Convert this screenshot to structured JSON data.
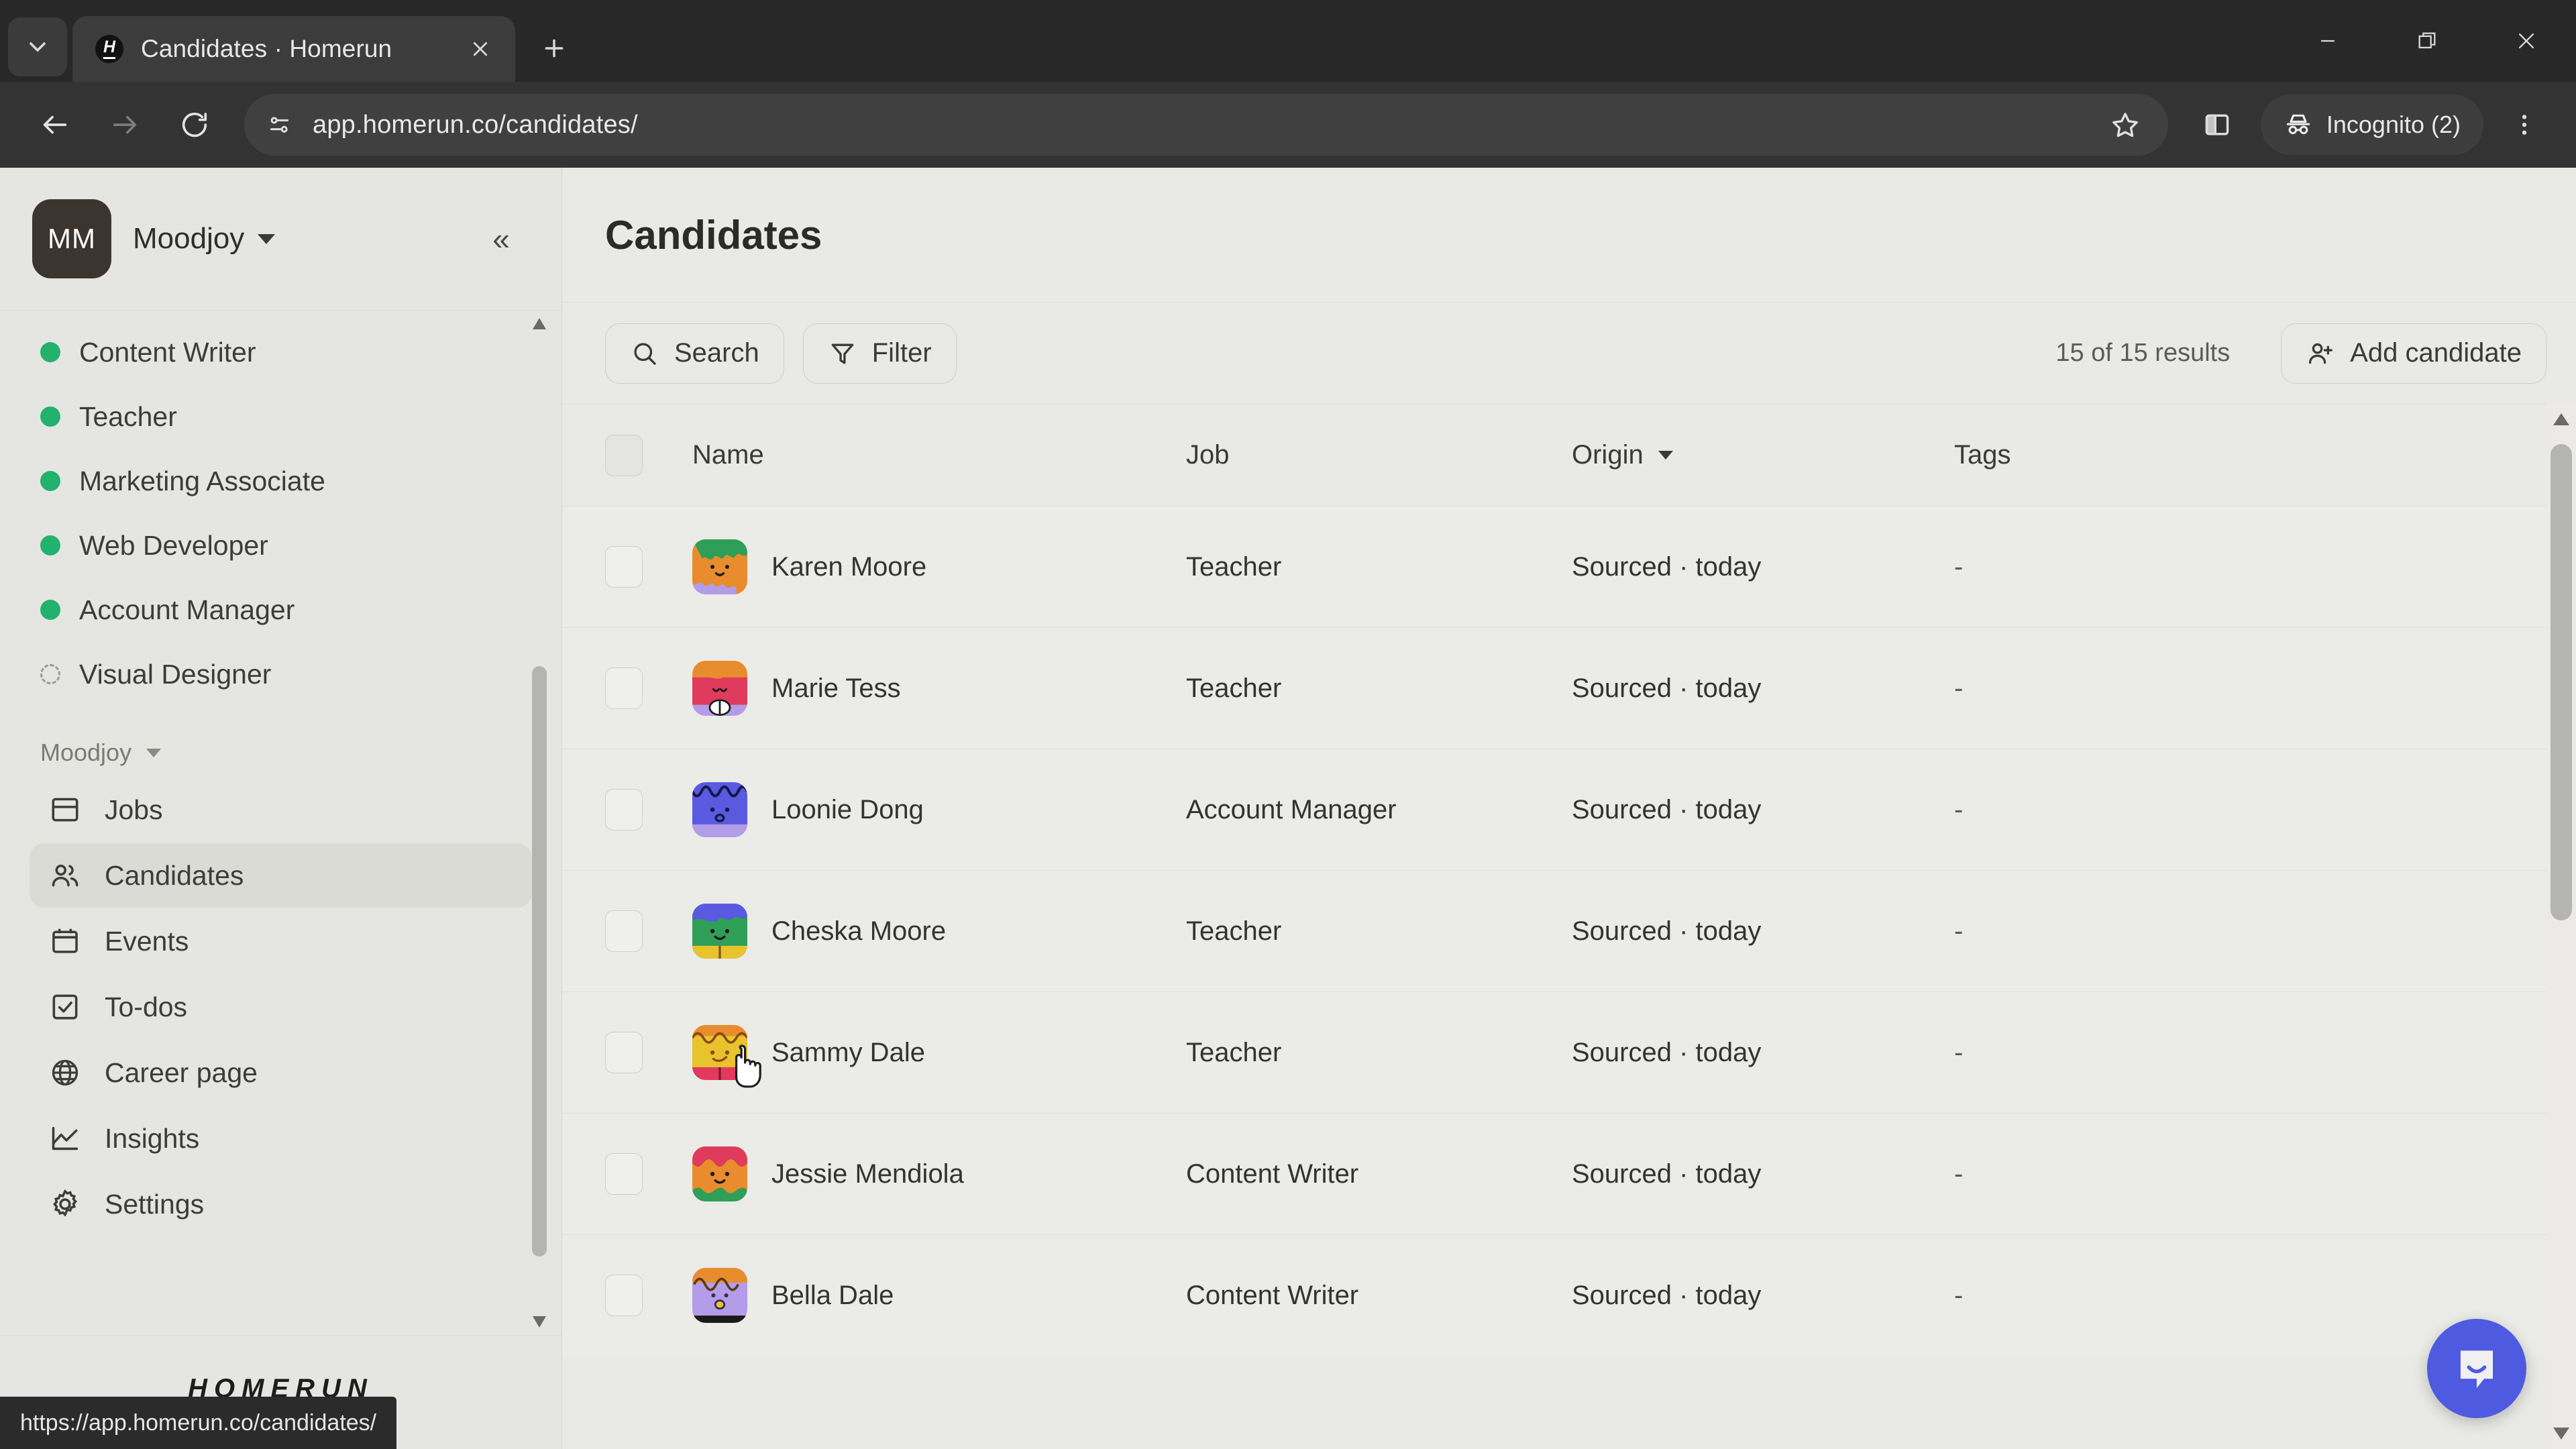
{
  "browser": {
    "tab": {
      "title": "Candidates · Homerun",
      "favicon_letter": "H"
    },
    "new_tab_label": "+",
    "address": "app.homerun.co/candidates/",
    "profile_label": "Incognito (2)",
    "status_url": "https://app.homerun.co/candidates/",
    "window": {
      "minimize": "–",
      "maximize": "❐",
      "close": "✕"
    }
  },
  "sidebar": {
    "org": {
      "initials": "MM",
      "name": "Moodjoy"
    },
    "jobs": [
      {
        "label": "Content Writer",
        "status": "published"
      },
      {
        "label": "Teacher",
        "status": "published"
      },
      {
        "label": "Marketing Associate",
        "status": "published"
      },
      {
        "label": "Web Developer",
        "status": "published"
      },
      {
        "label": "Account Manager",
        "status": "published"
      },
      {
        "label": "Visual Designer",
        "status": "draft"
      }
    ],
    "section_label": "Moodjoy",
    "nav": [
      {
        "label": "Jobs",
        "icon": "jobs-icon",
        "active": false
      },
      {
        "label": "Candidates",
        "icon": "candidates-icon",
        "active": true
      },
      {
        "label": "Events",
        "icon": "events-icon",
        "active": false
      },
      {
        "label": "To-dos",
        "icon": "todos-icon",
        "active": false
      },
      {
        "label": "Career page",
        "icon": "career-page-icon",
        "active": false
      },
      {
        "label": "Insights",
        "icon": "insights-icon",
        "active": false
      },
      {
        "label": "Settings",
        "icon": "settings-icon",
        "active": false
      }
    ],
    "footer_logo": "HOMERUN"
  },
  "main": {
    "title": "Candidates",
    "toolbar": {
      "search_label": "Search",
      "filter_label": "Filter",
      "results_label": "15 of 15 results",
      "add_candidate_label": "Add candidate"
    },
    "table": {
      "columns": [
        "Name",
        "Job",
        "Origin",
        "Tags"
      ],
      "sorted_column": "Origin",
      "rows": [
        {
          "name": "Karen Moore",
          "job": "Teacher",
          "origin": "Sourced · today",
          "tags": "-"
        },
        {
          "name": "Marie Tess",
          "job": "Teacher",
          "origin": "Sourced · today",
          "tags": "-"
        },
        {
          "name": "Loonie Dong",
          "job": "Account Manager",
          "origin": "Sourced · today",
          "tags": "-"
        },
        {
          "name": "Cheska Moore",
          "job": "Teacher",
          "origin": "Sourced · today",
          "tags": "-"
        },
        {
          "name": "Sammy Dale",
          "job": "Teacher",
          "origin": "Sourced · today",
          "tags": "-"
        },
        {
          "name": "Jessie Mendiola",
          "job": "Content Writer",
          "origin": "Sourced · today",
          "tags": "-"
        },
        {
          "name": "Bella Dale",
          "job": "Content Writer",
          "origin": "Sourced · today",
          "tags": "-"
        }
      ]
    }
  },
  "colors": {
    "accent_green": "#23b26d",
    "chat_blue": "#4e5ae0",
    "sidebar_bg": "#e5e5e2",
    "main_bg": "#e9e9e6",
    "chrome_dark": "#333333"
  },
  "chat": {
    "icon": "chat-bubble-icon"
  }
}
